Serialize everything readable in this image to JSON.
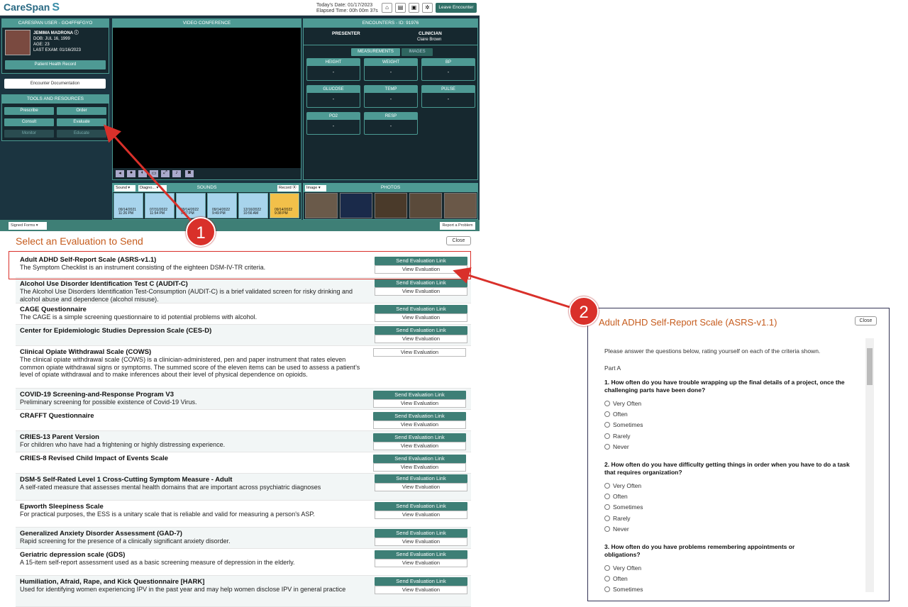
{
  "header": {
    "logo": "CareSpan",
    "date": "Today's Date: 01/17/2023",
    "elapsed": "Elapsed Time: 00h 00m 37s",
    "leave": "Leave Encounter"
  },
  "patient": {
    "panel_title": "CARESPAN USER - GO4FF6FGYO",
    "name": "JEMIMA MADRONA",
    "dob": "DOB: JUL 16, 1999",
    "age": "AGE: 23",
    "last_exam": "LAST EXAM: 01/16/2023",
    "record_button": "Patient Health Record",
    "encounter_doc": "Encounter Documentation"
  },
  "tools": {
    "title": "TOOLS AND RESOURCES",
    "buttons": [
      "Prescribe",
      "Order",
      "Consult",
      "Evaluate",
      "Monitor",
      "Educate"
    ]
  },
  "video": {
    "title": "VIDEO CONFERENCE"
  },
  "encounter": {
    "title": "ENCOUNTERS - ID: 91976",
    "presenter_label": "PRESENTER",
    "clinician_label": "CLINICIAN",
    "clinician_name": "Claire Brown",
    "tabs": [
      "MEASUREMENTS",
      "IMAGES"
    ],
    "measurements": [
      {
        "label": "HEIGHT",
        "value": "-"
      },
      {
        "label": "WEIGHT",
        "value": "-"
      },
      {
        "label": "BP",
        "value": "-"
      },
      {
        "label": "GLUCOSE",
        "value": "-"
      },
      {
        "label": "TEMP",
        "value": "-"
      },
      {
        "label": "PULSE",
        "value": "-"
      },
      {
        "label": "PO2",
        "value": "-"
      },
      {
        "label": "RESP",
        "value": "-"
      }
    ]
  },
  "sounds": {
    "title": "SOUNDS",
    "sound_select": "Sound",
    "diag_select": "Diagno...",
    "record": "Record",
    "items": [
      {
        "date": "09/14/2021",
        "time": "11:26 PM"
      },
      {
        "date": "07/31/2022",
        "time": "11:54 PM"
      },
      {
        "date": "09/14/2022",
        "time": "9:47 PM"
      },
      {
        "date": "09/14/2022",
        "time": "9:49 PM"
      },
      {
        "date": "12/16/2022",
        "time": "10:56 AM"
      },
      {
        "date": "09/14/2022",
        "time": "9:38 PM"
      }
    ]
  },
  "photos": {
    "title": "PHOTOS",
    "image_select": "Image"
  },
  "footer": {
    "signed_forms": "Signed Forms",
    "report": "Report a Problem"
  },
  "selector": {
    "title": "Select an Evaluation to Send",
    "close": "Close",
    "send_label": "Send Evaluation Link",
    "view_label": "View Evaluation",
    "evaluations": [
      {
        "name": "Adult ADHD Self-Report Scale (ASRS-v1.1)",
        "desc": "The Symptom Checklist is an instrument consisting of the eighteen DSM-IV-TR criteria."
      },
      {
        "name": "Alcohol Use Disorder Identification Test C (AUDIT-C)",
        "desc": "The Alcohol Use Disorders Identification Test-Consumption (AUDIT-C) is a brief validated screen for risky drinking and alcohol abuse and dependence (alcohol misuse)."
      },
      {
        "name": "CAGE Questionnaire",
        "desc": "The CAGE is a simple screening questionnaire to id potential problems with alcohol."
      },
      {
        "name": "Center for Epidemiologic Studies Depression Scale (CES-D)",
        "desc": ""
      },
      {
        "name": "Clinical Opiate Withdrawal Scale (COWS)",
        "desc": "The clinical opiate withdrawal scale (COWS) is a clinician-administered, pen and paper instrument that rates eleven common opiate withdrawal signs or symptoms. The summed score of the eleven items can be used to assess a patient's level of opiate withdrawal and to make inferences about their level of physical dependence on opioids."
      },
      {
        "name": "COVID-19 Screening-and-Response Program V3",
        "desc": "Preliminary screening for possible existence of Covid-19 Virus."
      },
      {
        "name": "CRAFFT Questionnaire",
        "desc": ""
      },
      {
        "name": "CRIES-13 Parent Version",
        "desc": "For children who have had a frightening or highly distressing experience."
      },
      {
        "name": "CRIES-8 Revised Child Impact of Events Scale",
        "desc": ""
      },
      {
        "name": "DSM-5 Self-Rated Level 1 Cross-Cutting Symptom Measure - Adult",
        "desc": "A self-rated measure that assesses mental health domains that are important across psychiatric diagnoses"
      },
      {
        "name": "Epworth Sleepiness Scale",
        "desc": "For practical purposes, the ESS is a unitary scale that is reliable and valid for measuring a person's ASP."
      },
      {
        "name": "Generalized Anxiety Disorder Assessment (GAD-7)",
        "desc": "Rapid screening for the presence of a clinically significant anxiety disorder."
      },
      {
        "name": "Geriatric depression scale (GDS)",
        "desc": "A 15-item self-report assessment used as a basic screening measure of depression in the elderly."
      },
      {
        "name": "Humiliation, Afraid, Rape, and Kick Questionnaire [HARK]",
        "desc": "Used for identifying women experiencing IPV in the past year and may help women disclose IPV in general practice"
      }
    ]
  },
  "modal": {
    "title": "Adult ADHD Self-Report Scale (ASRS-v1.1)",
    "close": "Close",
    "intro": "Please answer the questions below, rating yourself on each of the criteria shown.",
    "part": "Part A",
    "q1": "1. How often do you have trouble wrapping up the final details of a project, once the challenging parts have been done?",
    "q2": "2. How often do you have difficulty getting things in order when you have to do a task that requires organization?",
    "q3": "3. How often do you have problems remembering appointments or obligations?",
    "options": [
      "Very Often",
      "Often",
      "Sometimes",
      "Rarely",
      "Never"
    ]
  },
  "callouts": [
    "1",
    "2"
  ],
  "colors": {
    "teal": "#4e9a94",
    "orange": "#c65c1e",
    "arrow": "#d9302a"
  }
}
